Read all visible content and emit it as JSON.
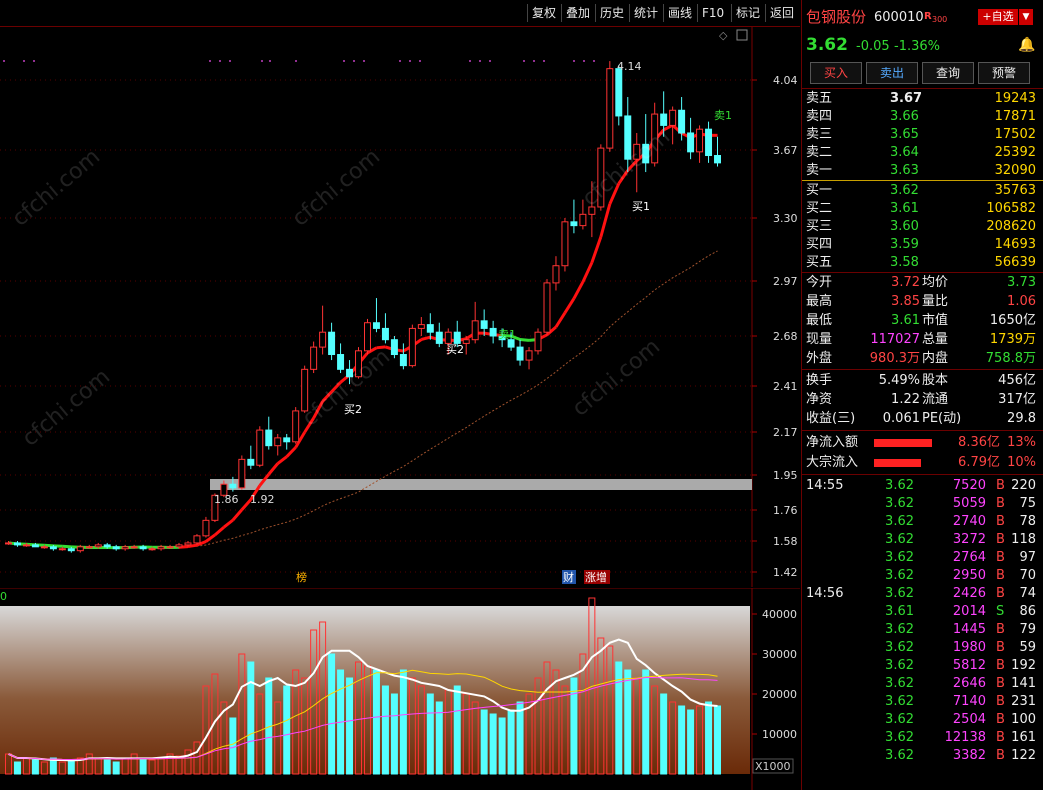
{
  "toolbar": {
    "items": [
      "复权",
      "叠加",
      "历史",
      "统计",
      "画线",
      "F10",
      "标记",
      "返回"
    ]
  },
  "stock": {
    "name": "包钢股份",
    "code": "600010",
    "badge": "R",
    "badge_sub": "300",
    "add_btn": "+自选",
    "price": "3.62",
    "change": "-0.05",
    "pct": "-1.36%"
  },
  "actions": [
    "买入",
    "卖出",
    "查询",
    "预警"
  ],
  "asks": [
    {
      "label": "卖五",
      "price": "3.67",
      "vol": "19243"
    },
    {
      "label": "卖四",
      "price": "3.66",
      "vol": "17871"
    },
    {
      "label": "卖三",
      "price": "3.65",
      "vol": "17502"
    },
    {
      "label": "卖二",
      "price": "3.64",
      "vol": "25392"
    },
    {
      "label": "卖一",
      "price": "3.63",
      "vol": "32090"
    }
  ],
  "bids": [
    {
      "label": "买一",
      "price": "3.62",
      "vol": "35763"
    },
    {
      "label": "买二",
      "price": "3.61",
      "vol": "106582"
    },
    {
      "label": "买三",
      "price": "3.60",
      "vol": "208620"
    },
    {
      "label": "买四",
      "price": "3.59",
      "vol": "14693"
    },
    {
      "label": "买五",
      "price": "3.58",
      "vol": "56639"
    }
  ],
  "stats1": [
    {
      "l1": "今开",
      "v1": "3.72",
      "l2": "均价",
      "v2": "3.73"
    },
    {
      "l1": "最高",
      "v1": "3.85",
      "l2": "量比",
      "v2": "1.06"
    },
    {
      "l1": "最低",
      "v1": "3.61",
      "l2": "市值",
      "v2": "1650亿"
    },
    {
      "l1": "现量",
      "v1": "117027",
      "l2": "总量",
      "v2": "1739万"
    },
    {
      "l1": "外盘",
      "v1": "980.3万",
      "l2": "内盘",
      "v2": "758.8万"
    }
  ],
  "stats2": [
    {
      "l1": "换手",
      "v1": "5.49%",
      "l2": "股本",
      "v2": "456亿"
    },
    {
      "l1": "净资",
      "v1": "1.22",
      "l2": "流通",
      "v2": "317亿"
    },
    {
      "l1": "收益(三)",
      "v1": "0.061",
      "l2": "PE(动)",
      "v2": "29.8"
    }
  ],
  "flows": [
    {
      "label": "净流入额",
      "value": "8.36亿",
      "pct": "13%",
      "fill": 0.8
    },
    {
      "label": "大宗流入",
      "value": "6.79亿",
      "pct": "10%",
      "fill": 0.65
    }
  ],
  "ticks": [
    {
      "time": "14:55",
      "price": "3.62",
      "vol": "7520",
      "side": "B",
      "n": "220"
    },
    {
      "time": "",
      "price": "3.62",
      "vol": "5059",
      "side": "B",
      "n": "75"
    },
    {
      "time": "",
      "price": "3.62",
      "vol": "2740",
      "side": "B",
      "n": "78"
    },
    {
      "time": "",
      "price": "3.62",
      "vol": "3272",
      "side": "B",
      "n": "118"
    },
    {
      "time": "",
      "price": "3.62",
      "vol": "2764",
      "side": "B",
      "n": "97"
    },
    {
      "time": "",
      "price": "3.62",
      "vol": "2950",
      "side": "B",
      "n": "70"
    },
    {
      "time": "14:56",
      "price": "3.62",
      "vol": "2426",
      "side": "B",
      "n": "74"
    },
    {
      "time": "",
      "price": "3.61",
      "vol": "2014",
      "side": "S",
      "n": "86"
    },
    {
      "time": "",
      "price": "3.62",
      "vol": "1445",
      "side": "B",
      "n": "79"
    },
    {
      "time": "",
      "price": "3.62",
      "vol": "1980",
      "side": "B",
      "n": "59"
    },
    {
      "time": "",
      "price": "3.62",
      "vol": "5812",
      "side": "B",
      "n": "192"
    },
    {
      "time": "",
      "price": "3.62",
      "vol": "2646",
      "side": "B",
      "n": "141"
    },
    {
      "time": "",
      "price": "3.62",
      "vol": "7140",
      "side": "B",
      "n": "231"
    },
    {
      "time": "",
      "price": "3.62",
      "vol": "2504",
      "side": "B",
      "n": "100"
    },
    {
      "time": "",
      "price": "3.62",
      "vol": "12138",
      "side": "B",
      "n": "161"
    },
    {
      "time": "",
      "price": "3.62",
      "vol": "3382",
      "side": "B",
      "n": "122"
    }
  ],
  "chart_labels": {
    "high": "4.14",
    "range_low": "1.86",
    "range_high": "1.92",
    "sell1a": "卖1",
    "sell1b": "卖1",
    "buy1": "买1",
    "buy2a": "买2",
    "buy2b": "买2",
    "sell1left": "卖1",
    "tag_bang": "榜",
    "tag_cai": "财",
    "tag_zz": "涨增",
    "vol_unit": "X1000",
    "vol_zero": "0"
  },
  "price_axis": [
    "4.04",
    "3.67",
    "3.30",
    "2.97",
    "2.68",
    "2.41",
    "2.17",
    "1.95",
    "1.76",
    "1.58",
    "1.42"
  ],
  "vol_axis": [
    "40000",
    "30000",
    "20000",
    "10000"
  ],
  "watermark": "cfchi.com",
  "chart_data": {
    "type": "candlestick",
    "price_axis_ticks": [
      4.04,
      3.67,
      3.3,
      2.97,
      2.68,
      2.41,
      2.17,
      1.95,
      1.76,
      1.58,
      1.42
    ],
    "volume_axis_ticks": [
      40000,
      30000,
      20000,
      10000
    ],
    "volume_unit": "X1000",
    "candles": [
      [
        1.57,
        1.58,
        1.56,
        1.57
      ],
      [
        1.57,
        1.58,
        1.55,
        1.56
      ],
      [
        1.56,
        1.57,
        1.55,
        1.56
      ],
      [
        1.56,
        1.57,
        1.55,
        1.55
      ],
      [
        1.55,
        1.56,
        1.54,
        1.55
      ],
      [
        1.55,
        1.56,
        1.53,
        1.54
      ],
      [
        1.54,
        1.55,
        1.53,
        1.54
      ],
      [
        1.54,
        1.55,
        1.52,
        1.53
      ],
      [
        1.53,
        1.56,
        1.52,
        1.55
      ],
      [
        1.55,
        1.56,
        1.54,
        1.55
      ],
      [
        1.55,
        1.57,
        1.54,
        1.56
      ],
      [
        1.56,
        1.57,
        1.54,
        1.55
      ],
      [
        1.55,
        1.56,
        1.53,
        1.54
      ],
      [
        1.54,
        1.56,
        1.53,
        1.55
      ],
      [
        1.55,
        1.56,
        1.54,
        1.55
      ],
      [
        1.55,
        1.56,
        1.53,
        1.54
      ],
      [
        1.54,
        1.55,
        1.53,
        1.54
      ],
      [
        1.54,
        1.56,
        1.53,
        1.55
      ],
      [
        1.55,
        1.56,
        1.54,
        1.55
      ],
      [
        1.55,
        1.57,
        1.54,
        1.56
      ],
      [
        1.56,
        1.58,
        1.55,
        1.57
      ],
      [
        1.57,
        1.62,
        1.56,
        1.61
      ],
      [
        1.61,
        1.72,
        1.6,
        1.7
      ],
      [
        1.7,
        1.85,
        1.69,
        1.84
      ],
      [
        1.84,
        1.92,
        1.83,
        1.9
      ],
      [
        1.9,
        1.94,
        1.86,
        1.88
      ],
      [
        1.88,
        2.05,
        1.87,
        2.03
      ],
      [
        2.03,
        2.1,
        1.98,
        2.0
      ],
      [
        2.0,
        2.2,
        1.99,
        2.18
      ],
      [
        2.18,
        2.25,
        2.08,
        2.1
      ],
      [
        2.1,
        2.16,
        2.05,
        2.14
      ],
      [
        2.14,
        2.16,
        2.08,
        2.12
      ],
      [
        2.12,
        2.3,
        2.11,
        2.28
      ],
      [
        2.28,
        2.52,
        2.27,
        2.5
      ],
      [
        2.5,
        2.65,
        2.48,
        2.62
      ],
      [
        2.62,
        2.84,
        2.58,
        2.7
      ],
      [
        2.7,
        2.75,
        2.55,
        2.58
      ],
      [
        2.58,
        2.64,
        2.48,
        2.5
      ],
      [
        2.5,
        2.55,
        2.42,
        2.46
      ],
      [
        2.46,
        2.62,
        2.45,
        2.6
      ],
      [
        2.6,
        2.77,
        2.58,
        2.75
      ],
      [
        2.75,
        2.88,
        2.7,
        2.72
      ],
      [
        2.72,
        2.8,
        2.64,
        2.66
      ],
      [
        2.66,
        2.68,
        2.56,
        2.58
      ],
      [
        2.58,
        2.64,
        2.5,
        2.52
      ],
      [
        2.52,
        2.74,
        2.51,
        2.72
      ],
      [
        2.72,
        2.78,
        2.68,
        2.74
      ],
      [
        2.74,
        2.8,
        2.66,
        2.7
      ],
      [
        2.7,
        2.75,
        2.62,
        2.64
      ],
      [
        2.64,
        2.72,
        2.58,
        2.7
      ],
      [
        2.7,
        2.76,
        2.62,
        2.64
      ],
      [
        2.64,
        2.68,
        2.58,
        2.66
      ],
      [
        2.66,
        2.86,
        2.64,
        2.76
      ],
      [
        2.76,
        2.82,
        2.68,
        2.72
      ],
      [
        2.72,
        2.76,
        2.64,
        2.68
      ],
      [
        2.68,
        2.72,
        2.62,
        2.66
      ],
      [
        2.66,
        2.7,
        2.6,
        2.62
      ],
      [
        2.62,
        2.66,
        2.52,
        2.55
      ],
      [
        2.55,
        2.62,
        2.5,
        2.6
      ],
      [
        2.6,
        2.72,
        2.58,
        2.7
      ],
      [
        2.7,
        2.98,
        2.68,
        2.96
      ],
      [
        2.96,
        3.1,
        2.92,
        3.05
      ],
      [
        3.05,
        3.3,
        3.02,
        3.28
      ],
      [
        3.28,
        3.4,
        3.22,
        3.26
      ],
      [
        3.26,
        3.4,
        3.24,
        3.32
      ],
      [
        3.32,
        3.5,
        3.2,
        3.36
      ],
      [
        3.36,
        3.7,
        3.34,
        3.68
      ],
      [
        3.68,
        4.14,
        3.66,
        4.1
      ],
      [
        4.1,
        4.12,
        3.8,
        3.85
      ],
      [
        3.85,
        3.95,
        3.55,
        3.62
      ],
      [
        3.62,
        3.76,
        3.44,
        3.7
      ],
      [
        3.7,
        3.86,
        3.55,
        3.6
      ],
      [
        3.6,
        3.92,
        3.58,
        3.86
      ],
      [
        3.86,
        3.98,
        3.74,
        3.8
      ],
      [
        3.8,
        3.9,
        3.7,
        3.88
      ],
      [
        3.88,
        3.95,
        3.72,
        3.76
      ],
      [
        3.76,
        3.84,
        3.62,
        3.66
      ],
      [
        3.66,
        3.8,
        3.6,
        3.78
      ],
      [
        3.78,
        3.82,
        3.6,
        3.64
      ],
      [
        3.64,
        3.74,
        3.58,
        3.6
      ]
    ],
    "volume": [
      5000,
      3000,
      4000,
      3500,
      3000,
      4000,
      3000,
      3500,
      4000,
      5000,
      4000,
      3500,
      3000,
      4000,
      5000,
      4000,
      3500,
      4000,
      5000,
      4500,
      6000,
      8000,
      22000,
      25000,
      18000,
      14000,
      30000,
      28000,
      20000,
      24000,
      18000,
      22000,
      26000,
      24000,
      36000,
      38000,
      30000,
      26000,
      24000,
      28000,
      27000,
      26000,
      22000,
      20000,
      26000,
      24000,
      22000,
      20000,
      18000,
      21000,
      22000,
      20000,
      18000,
      16000,
      15000,
      14000,
      16000,
      18000,
      20000,
      24000,
      28000,
      26000,
      22000,
      24000,
      30000,
      44000,
      34000,
      32000,
      28000,
      26000,
      24000,
      26000,
      22000,
      20000,
      18000,
      17000,
      16000,
      17000,
      18000,
      17000
    ]
  }
}
